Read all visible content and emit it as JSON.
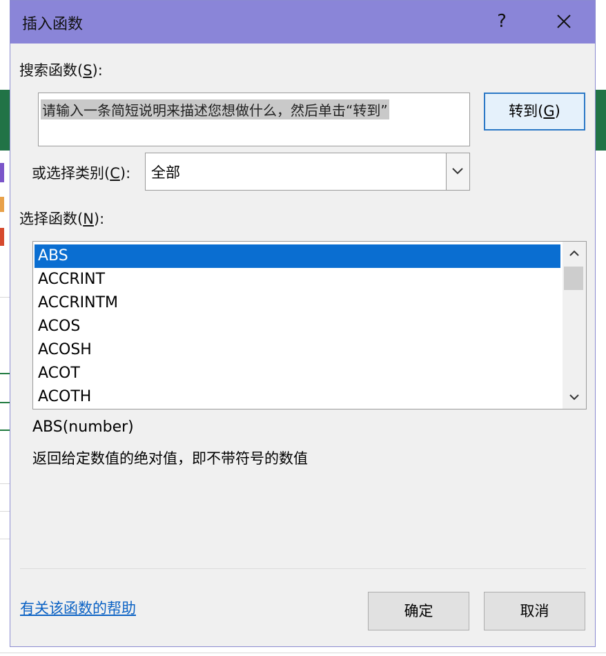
{
  "dialog": {
    "title": "插入函数",
    "help_icon": "?",
    "close_icon": "close-icon"
  },
  "search": {
    "label_prefix": "搜索函数(",
    "label_key": "S",
    "label_suffix": "):",
    "value": "请输入一条简短说明来描述您想做什么，然后单击“转到”",
    "goto_prefix": "转到(",
    "goto_key": "G",
    "goto_suffix": ")"
  },
  "category": {
    "label_prefix": "或选择类别(",
    "label_key": "C",
    "label_suffix": "):",
    "selected": "全部"
  },
  "functions": {
    "label_prefix": "选择函数(",
    "label_key": "N",
    "label_suffix": "):",
    "items": [
      "ABS",
      "ACCRINT",
      "ACCRINTM",
      "ACOS",
      "ACOSH",
      "ACOT",
      "ACOTH"
    ],
    "selected_index": 0
  },
  "details": {
    "signature": "ABS(number)",
    "description": "返回给定数值的绝对值，即不带符号的数值"
  },
  "footer": {
    "help_link": "有关该函数的帮助",
    "ok": "确定",
    "cancel": "取消"
  },
  "colors": {
    "titlebar": "#8a85d8",
    "selection": "#0a6ed1",
    "link": "#0b62c4"
  }
}
